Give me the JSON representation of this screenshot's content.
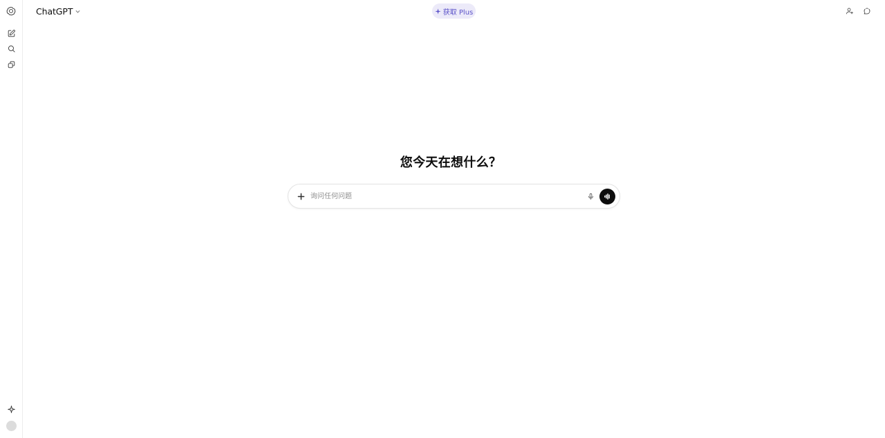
{
  "header": {
    "model_name": "ChatGPT",
    "upgrade_label": "获取 Plus",
    "upgrade_color": "#5b52c9",
    "upgrade_bg": "#eceaf9"
  },
  "sidebar": {
    "icons": [
      "openai-logo-icon",
      "new-chat-icon",
      "search-icon",
      "library-icon",
      "sparkle-icon"
    ]
  },
  "main": {
    "headline": "您今天在想什么？",
    "composer": {
      "placeholder": "询问任何问题"
    }
  },
  "header_right_icons": [
    "share-user-icon",
    "temporary-chat-icon"
  ]
}
